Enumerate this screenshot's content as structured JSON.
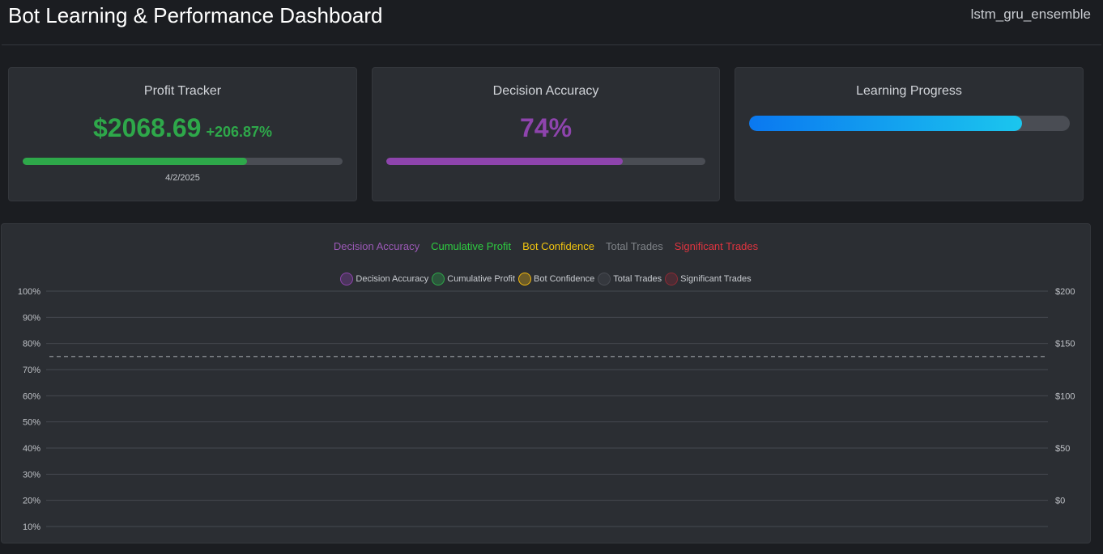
{
  "header": {
    "title": "Bot Learning & Performance Dashboard",
    "model": "lstm_gru_ensemble"
  },
  "profit": {
    "title": "Profit Tracker",
    "amount": "$2068.69",
    "change": "+206.87%",
    "bar_fraction": 0.7,
    "date": "4/2/2025",
    "color": "#2ea84a"
  },
  "accuracy": {
    "title": "Decision Accuracy",
    "value": "74%",
    "bar_fraction": 0.74,
    "color": "#8e44ad"
  },
  "learning": {
    "title": "Learning Progress",
    "bar_fraction": 0.85
  },
  "chart_tabs": [
    {
      "label": "Decision Accuracy",
      "color": "#9b59b6"
    },
    {
      "label": "Cumulative Profit",
      "color": "#2ecc40"
    },
    {
      "label": "Bot Confidence",
      "color": "#f1c40f"
    },
    {
      "label": "Total Trades",
      "color": "#7f8388"
    },
    {
      "label": "Significant Trades",
      "color": "#e0343f"
    }
  ],
  "chart_data": {
    "type": "line",
    "legend": [
      {
        "name": "Decision Accuracy",
        "color": "#8e44ad"
      },
      {
        "name": "Cumulative Profit",
        "color": "#2ea84a"
      },
      {
        "name": "Bot Confidence",
        "color": "#f1b70f"
      },
      {
        "name": "Total Trades",
        "color": "#4a4d54"
      },
      {
        "name": "Significant Trades",
        "color": "#8e2b35"
      }
    ],
    "y_left_ticks": [
      "100%",
      "90%",
      "80%",
      "70%",
      "60%",
      "50%",
      "40%",
      "30%",
      "20%",
      "10%"
    ],
    "y_right_ticks": [
      "$200",
      "$150",
      "$100",
      "$50",
      "$0"
    ],
    "y_left_range": [
      10,
      100
    ],
    "y_right_range": [
      0,
      200
    ],
    "reference_line_pct": 75,
    "series": [],
    "grid": true,
    "legend_position": "top"
  }
}
